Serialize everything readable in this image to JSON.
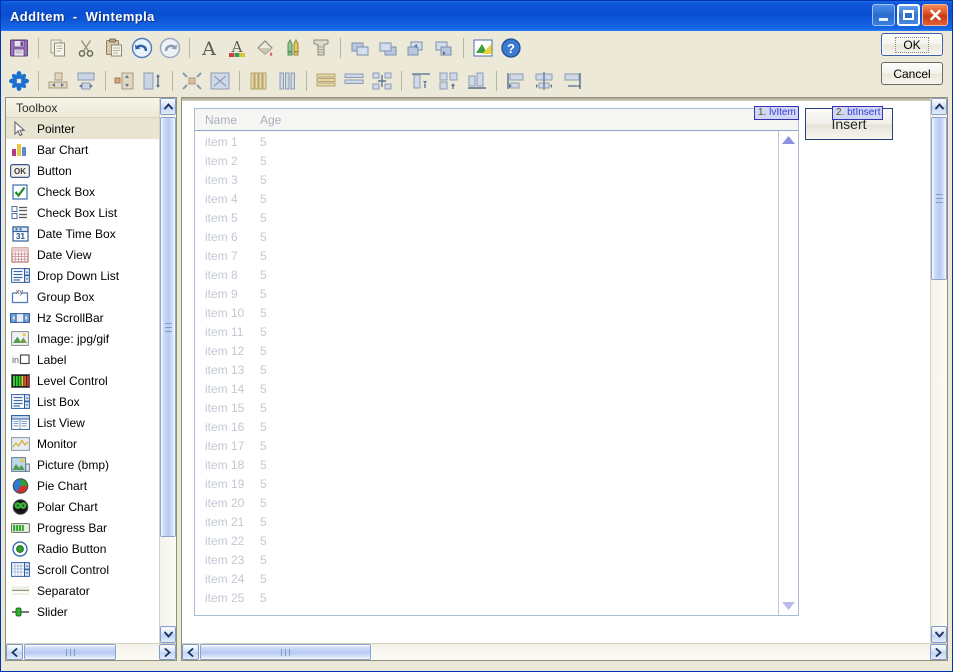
{
  "window": {
    "title": "AddItem  -  Wintempla",
    "caption_buttons": [
      {
        "name": "minimize",
        "label": "Minimize"
      },
      {
        "name": "maximize",
        "label": "Restore"
      },
      {
        "name": "close",
        "label": "Close"
      }
    ]
  },
  "dialog_buttons": {
    "ok_label": "OK",
    "cancel_label": "Cancel"
  },
  "toolbar": {
    "row1": [
      {
        "name": "save-icon",
        "tip": "Save"
      },
      {
        "sep": true
      },
      {
        "name": "copy-icon",
        "tip": "Copy"
      },
      {
        "name": "cut-icon",
        "tip": "Cut"
      },
      {
        "name": "paste-icon",
        "tip": "Paste"
      },
      {
        "name": "undo-icon",
        "tip": "Undo"
      },
      {
        "name": "redo-icon",
        "tip": "Redo"
      },
      {
        "sep": true
      },
      {
        "name": "font-icon",
        "tip": "Font"
      },
      {
        "name": "font-color-icon",
        "tip": "Font Color"
      },
      {
        "name": "fill-color-icon",
        "tip": "Fill Color"
      },
      {
        "name": "pens-icon",
        "tip": "Pen"
      },
      {
        "name": "screw-icon",
        "tip": "Properties"
      },
      {
        "sep": true
      },
      {
        "name": "bring-to-front-icon",
        "tip": "Bring To Front"
      },
      {
        "name": "send-to-back-icon",
        "tip": "Send To Back"
      },
      {
        "name": "bring-forward-icon",
        "tip": "Bring Forward"
      },
      {
        "name": "send-backward-icon",
        "tip": "Send Backward"
      },
      {
        "sep": true
      },
      {
        "name": "preview-icon",
        "tip": "Preview"
      },
      {
        "name": "help-icon",
        "tip": "Help"
      }
    ],
    "row2": [
      {
        "name": "snowflake-icon",
        "tip": "Auto Arrange"
      },
      {
        "sep": true
      },
      {
        "name": "center-horizontally-icon",
        "tip": "Center Horizontally"
      },
      {
        "name": "center-vertically-icon",
        "tip": "Center Vertically"
      },
      {
        "sep": true
      },
      {
        "name": "stretch-height-icon",
        "tip": "Stretch Height"
      },
      {
        "name": "stretch-width-icon",
        "tip": "Stretch Width"
      },
      {
        "sep": true
      },
      {
        "name": "shrink-icon",
        "tip": "Shrink"
      },
      {
        "name": "expand-icon",
        "tip": "Expand"
      },
      {
        "sep": true
      },
      {
        "name": "equal-width-icon",
        "tip": "Equal Width"
      },
      {
        "name": "equal-spacing-vertical-icon",
        "tip": "Equal Spacing Vertical"
      },
      {
        "sep": true
      },
      {
        "name": "equal-height-icon",
        "tip": "Equal Height"
      },
      {
        "name": "equal-spacing-horizontal-icon",
        "tip": "Equal Spacing Horizontal"
      },
      {
        "name": "distribute-icon",
        "tip": "Distribute"
      },
      {
        "sep": true
      },
      {
        "name": "align-top-icon",
        "tip": "Align Top"
      },
      {
        "name": "align-middle-icon",
        "tip": "Align Middle"
      },
      {
        "name": "align-bottom-icon",
        "tip": "Align Bottom"
      },
      {
        "sep": true
      },
      {
        "name": "align-left-icon",
        "tip": "Align Left"
      },
      {
        "name": "align-center-icon",
        "tip": "Align Center"
      },
      {
        "name": "align-right-icon",
        "tip": "Align Right"
      }
    ]
  },
  "toolbox": {
    "header": "Toolbox",
    "selected": "Pointer",
    "items": [
      {
        "label": "Pointer",
        "icon": "pointer-icon"
      },
      {
        "label": "Bar Chart",
        "icon": "bar-chart-icon"
      },
      {
        "label": "Button",
        "icon": "button-icon"
      },
      {
        "label": "Check Box",
        "icon": "check-box-icon"
      },
      {
        "label": "Check Box List",
        "icon": "check-box-list-icon"
      },
      {
        "label": "Date Time Box",
        "icon": "date-time-box-icon"
      },
      {
        "label": "Date View",
        "icon": "date-view-icon"
      },
      {
        "label": "Drop Down List",
        "icon": "drop-down-list-icon"
      },
      {
        "label": "Group Box",
        "icon": "group-box-icon"
      },
      {
        "label": "Hz ScrollBar",
        "icon": "hz-scrollbar-icon"
      },
      {
        "label": "Image: jpg/gif",
        "icon": "image-icon"
      },
      {
        "label": "Label",
        "icon": "label-icon"
      },
      {
        "label": "Level Control",
        "icon": "level-control-icon"
      },
      {
        "label": "List Box",
        "icon": "list-box-icon"
      },
      {
        "label": "List View",
        "icon": "list-view-icon"
      },
      {
        "label": "Monitor",
        "icon": "monitor-icon"
      },
      {
        "label": "Picture (bmp)",
        "icon": "picture-icon"
      },
      {
        "label": "Pie Chart",
        "icon": "pie-chart-icon"
      },
      {
        "label": "Polar Chart",
        "icon": "polar-chart-icon"
      },
      {
        "label": "Progress Bar",
        "icon": "progress-bar-icon"
      },
      {
        "label": "Radio Button",
        "icon": "radio-button-icon"
      },
      {
        "label": "Scroll Control",
        "icon": "scroll-control-icon"
      },
      {
        "label": "Separator",
        "icon": "separator-icon"
      },
      {
        "label": "Slider",
        "icon": "slider-icon"
      }
    ]
  },
  "canvas": {
    "listview": {
      "tag": "1. lvItem",
      "tag_number": "1.",
      "tag_name": "lvItem",
      "columns": [
        "Name",
        "Age"
      ],
      "rows": [
        {
          "name": "item 1",
          "age": "5"
        },
        {
          "name": "item 2",
          "age": "5"
        },
        {
          "name": "item 3",
          "age": "5"
        },
        {
          "name": "item 4",
          "age": "5"
        },
        {
          "name": "item 5",
          "age": "5"
        },
        {
          "name": "item 6",
          "age": "5"
        },
        {
          "name": "item 7",
          "age": "5"
        },
        {
          "name": "item 8",
          "age": "5"
        },
        {
          "name": "item 9",
          "age": "5"
        },
        {
          "name": "item 10",
          "age": "5"
        },
        {
          "name": "item 11",
          "age": "5"
        },
        {
          "name": "item 12",
          "age": "5"
        },
        {
          "name": "item 13",
          "age": "5"
        },
        {
          "name": "item 14",
          "age": "5"
        },
        {
          "name": "item 15",
          "age": "5"
        },
        {
          "name": "item 16",
          "age": "5"
        },
        {
          "name": "item 17",
          "age": "5"
        },
        {
          "name": "item 18",
          "age": "5"
        },
        {
          "name": "item 19",
          "age": "5"
        },
        {
          "name": "item 20",
          "age": "5"
        },
        {
          "name": "item 21",
          "age": "5"
        },
        {
          "name": "item 22",
          "age": "5"
        },
        {
          "name": "item 23",
          "age": "5"
        },
        {
          "name": "item 24",
          "age": "5"
        },
        {
          "name": "item 25",
          "age": "5"
        }
      ]
    },
    "insert_button": {
      "label": "Insert",
      "tag": "2. btInsert",
      "tag_number": "2.",
      "tag_name": "btInsert"
    }
  },
  "colors": {
    "title_bar": "#0a4ed2",
    "toolbar_bg": "#ece9d8",
    "scroll_thumb": "#b8caf3",
    "tag_bg": "#cfd8f4",
    "tag_border": "#3a2fb0",
    "selection": "#e8e4d2"
  }
}
